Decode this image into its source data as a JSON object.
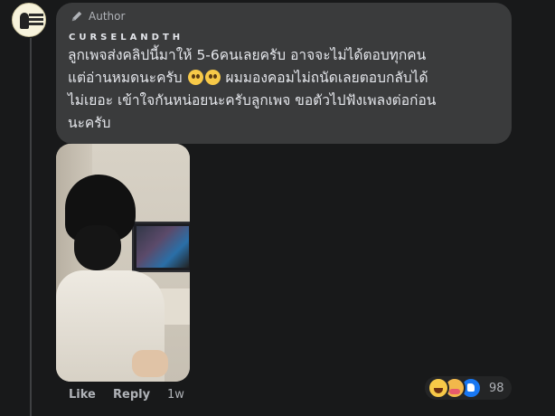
{
  "comment": {
    "badge_label": "Author",
    "author_name": "CURSELANDTH",
    "text_lines": [
      "ลูกเพจส่งคลิปนี้มาให้ 5-6คนเลยครับ อาจจะไม่ได้ตอบทุกคน",
      "แต่อ่านหมดนะครับ",
      "ผมมองคอมไม่ถนัดเลยตอบกลับได้",
      "ไม่เยอะ เข้าใจกันหน่อยนะครับลูกเพจ ขอตัวไปฟังเพลงต่อก่อน",
      "นะครับ"
    ],
    "inline_emoji": [
      "pleading-face-icon",
      "pleading-face-icon"
    ]
  },
  "actions": {
    "like_label": "Like",
    "reply_label": "Reply",
    "timestamp": "1w"
  },
  "reactions": {
    "icons": [
      "haha-reaction-icon",
      "care-reaction-icon",
      "like-reaction-icon"
    ],
    "count": "98"
  },
  "colors": {
    "background": "#18191a",
    "bubble": "#3a3b3c",
    "primary_text": "#e4e6eb",
    "secondary_text": "#b0b3b8",
    "like_blue": "#1877f2"
  }
}
